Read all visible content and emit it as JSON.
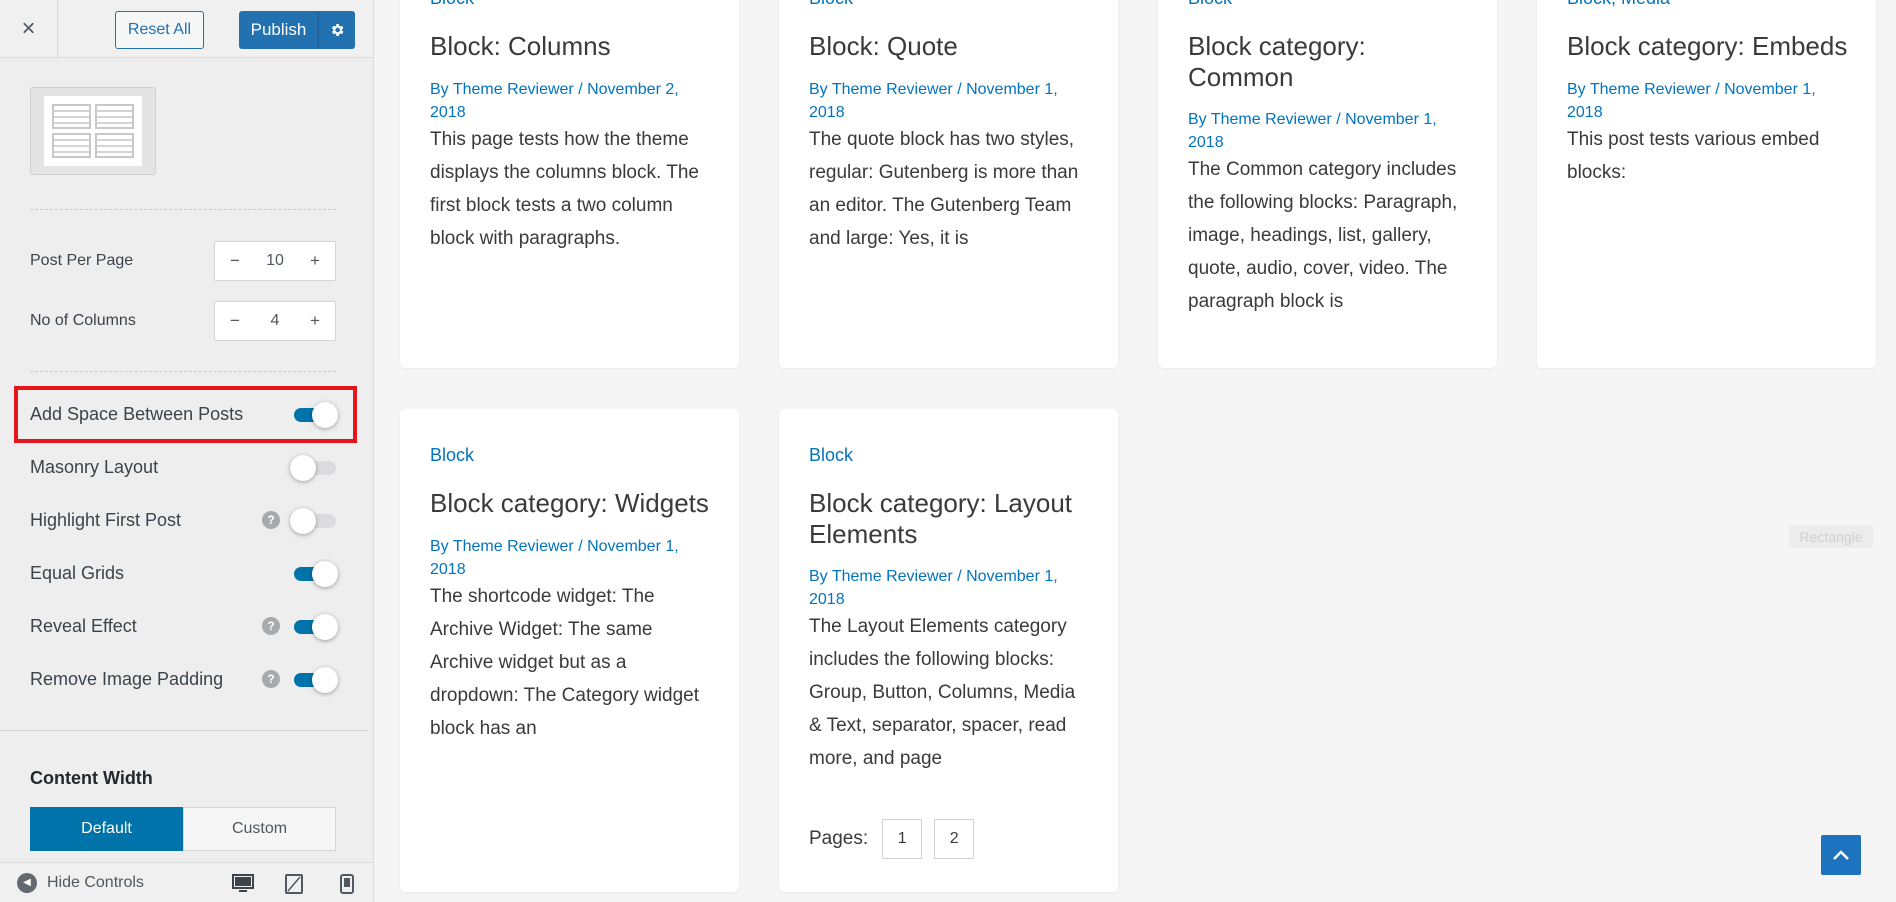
{
  "topbar": {
    "close_label": "×",
    "reset_label": "Reset All",
    "publish_label": "Publish"
  },
  "settings": {
    "post_per_page": {
      "label": "Post Per Page",
      "value": "10"
    },
    "no_of_columns": {
      "label": "No of Columns",
      "value": "4"
    },
    "stepper_minus": "−",
    "stepper_plus": "+",
    "help_glyph": "?",
    "toggles": [
      {
        "label": "Add Space Between Posts",
        "on": true,
        "help": false
      },
      {
        "label": "Masonry Layout",
        "on": false,
        "help": false
      },
      {
        "label": "Highlight First Post",
        "on": false,
        "help": true
      },
      {
        "label": "Equal Grids",
        "on": true,
        "help": false
      },
      {
        "label": "Reveal Effect",
        "on": true,
        "help": true
      },
      {
        "label": "Remove Image Padding",
        "on": true,
        "help": true
      }
    ],
    "content_width": {
      "title": "Content Width",
      "options": [
        "Default",
        "Custom"
      ],
      "selected": "Default"
    }
  },
  "footer": {
    "hide_controls_label": "Hide Controls",
    "devices": [
      "desktop-icon",
      "tablet-icon",
      "mobile-icon"
    ]
  },
  "posts": [
    {
      "category": "Block",
      "title": "Block: Columns",
      "meta": "By Theme Reviewer / November 2, 2018",
      "excerpt": "This page tests how the theme displays the columns block. The first block tests a two column block with paragraphs."
    },
    {
      "category": "Block",
      "title": "Block: Quote",
      "meta": "By Theme Reviewer / November 1, 2018",
      "excerpt": "The quote block has two styles, regular: Gutenberg is more than an editor. The Gutenberg Team and large: Yes, it is"
    },
    {
      "category": "Block",
      "title": "Block category: Common",
      "meta": "By Theme Reviewer / November 1, 2018",
      "excerpt": "The Common category includes the following blocks: Paragraph, image, headings, list, gallery, quote, audio, cover, video. The paragraph block is"
    },
    {
      "category": "Block, Media",
      "title": "Block category: Embeds",
      "meta": "By Theme Reviewer / November 1, 2018",
      "excerpt": "This post tests various embed blocks:"
    },
    {
      "category": "Block",
      "title": "Block category: Widgets",
      "meta": "By Theme Reviewer / November 1, 2018",
      "excerpt": "The shortcode widget: The Archive Widget: The same Archive widget but as a dropdown: The Category widget block has an"
    },
    {
      "category": "Block",
      "title": "Block category: Layout Elements",
      "meta": "By Theme Reviewer / November 1, 2018",
      "excerpt": "The Layout Elements category includes the following blocks: Group, Button, Columns, Media & Text, separator, spacer, read more, and page"
    }
  ],
  "pagination": {
    "label": "Pages:",
    "pages": [
      "1",
      "2"
    ]
  },
  "overlay": {
    "rectangle_label": "Rectangle"
  },
  "colors": {
    "accent": "#0073aa",
    "link": "#0274be",
    "highlight": "#e5161b",
    "scroll_top": "#1e73be"
  }
}
